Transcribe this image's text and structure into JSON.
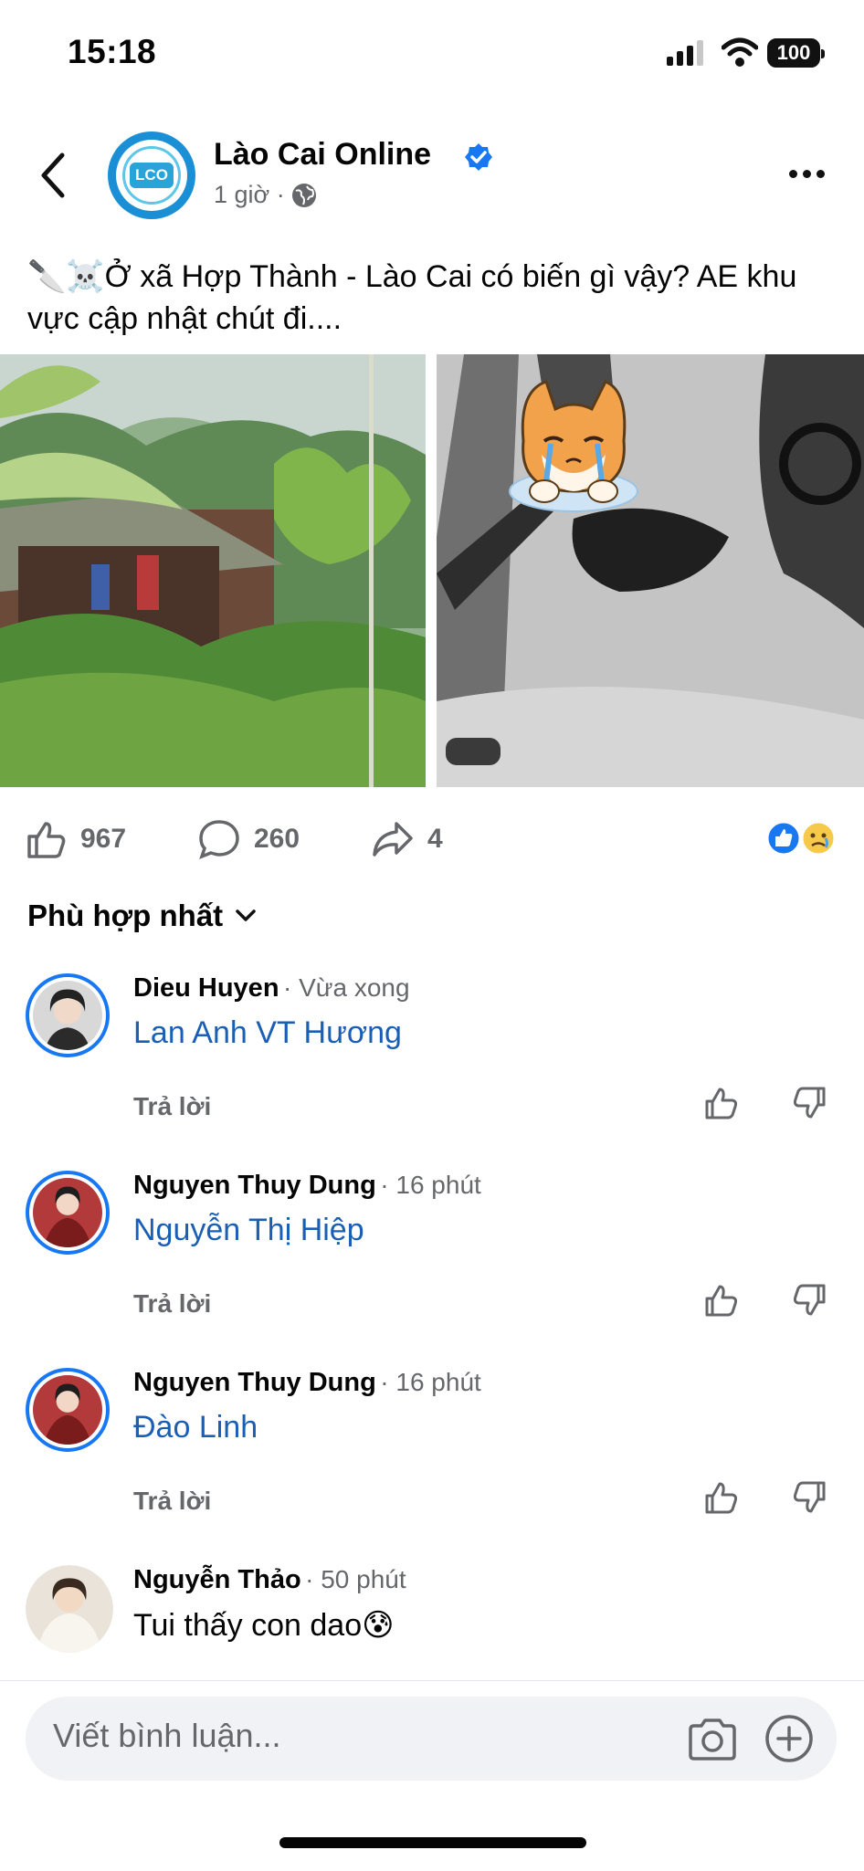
{
  "status_bar": {
    "time": "15:18",
    "battery": "100"
  },
  "post": {
    "page_name": "Lào Cai Online",
    "avatar_text": "LCO",
    "time": "1 giờ ·",
    "caption_emoji": "🔪☠️",
    "caption": "Ở xã Hợp Thành - Lào Cai có biến gì vậy? AE khu vực cập nhật chút đi....",
    "likes": "967",
    "comments": "260",
    "shares": "4"
  },
  "sort_label": "Phù hợp nhất",
  "comments": [
    {
      "name": "Dieu Huyen",
      "time": "· Vừa xong",
      "text": "Lan Anh VT Hương",
      "reply": "Trả lời"
    },
    {
      "name": "Nguyen Thuy Dung",
      "time": "· 16 phút",
      "text": "Nguyễn Thị Hiệp",
      "reply": "Trả lời"
    },
    {
      "name": "Nguyen Thuy Dung",
      "time": "· 16 phút",
      "text": "Đào Linh",
      "reply": "Trả lời"
    },
    {
      "name": "Nguyễn Thảo",
      "time": "· 50 phút",
      "text": "Tui thấy con dao😰"
    }
  ],
  "composer": {
    "placeholder": "Viết bình luận..."
  },
  "colors": {
    "accent": "#1877f2",
    "link": "#1a5fb4",
    "muted": "#65676b"
  }
}
